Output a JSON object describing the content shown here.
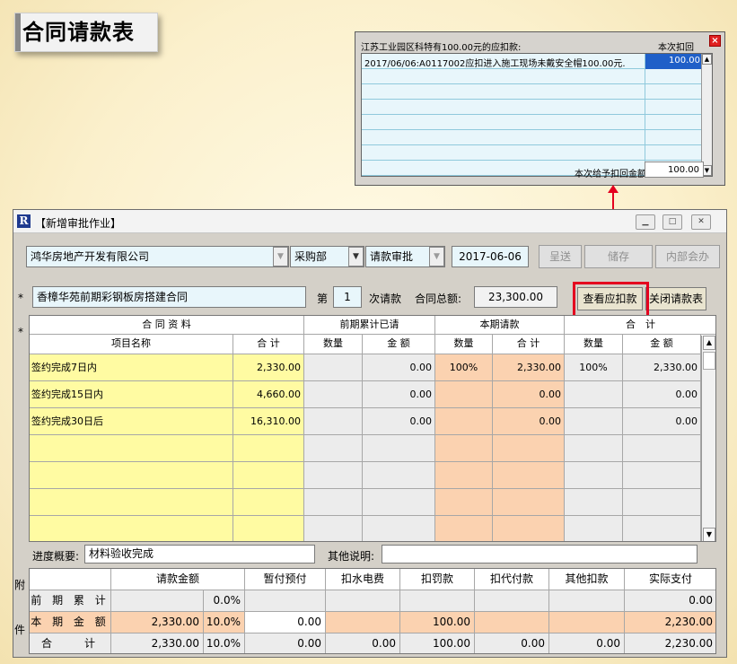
{
  "page_title": "合同请款表",
  "popup": {
    "header": "江苏工业园区科特有100.00元的应扣款:",
    "col_right": "本次扣回",
    "close": "×",
    "rows": [
      {
        "text": "2017/06/06:A0117002应扣进入施工现场未戴安全帽100.00元.",
        "amount": "100.00"
      }
    ],
    "footer_label": "本次给予扣回金额:",
    "footer_value": "100.00"
  },
  "window": {
    "title": "【新增审批作业】",
    "logo": "R",
    "company": "鸿华房地产开发有限公司",
    "department": "采购部",
    "type": "请款审批",
    "date": "2017-06-06",
    "buttons": {
      "submit": "呈送",
      "save": "储存",
      "internal": "内部会办"
    },
    "contract_name": "香樟华苑前期彩钢板房搭建合同",
    "seq_prefix": "第",
    "seq_no": "1",
    "seq_suffix": "次请款",
    "total_label": "合同总额:",
    "total_value": "23,300.00",
    "view_deduct": "查看应扣款",
    "close_form": "关闭请款表",
    "star": "*"
  },
  "items": {
    "group_headers": [
      "合 同 资 料",
      "前期累计已请",
      "本期请款",
      "合　计"
    ],
    "sub_headers": [
      "项目名称",
      "合 计",
      "数量",
      "金 额",
      "数量",
      "合 计",
      "数量",
      "金 额"
    ],
    "rows": [
      {
        "name": "签约完成7日内",
        "total": "2,330.00",
        "prev_qty": "",
        "prev_amt": "0.00",
        "cur_qty": "100%",
        "cur_amt": "2,330.00",
        "sum_qty": "100%",
        "sum_amt": "2,330.00"
      },
      {
        "name": "签约完成15日内",
        "total": "4,660.00",
        "prev_qty": "",
        "prev_amt": "0.00",
        "cur_qty": "",
        "cur_amt": "0.00",
        "sum_qty": "",
        "sum_amt": "0.00"
      },
      {
        "name": "签约完成30日后",
        "total": "16,310.00",
        "prev_qty": "",
        "prev_amt": "0.00",
        "cur_qty": "",
        "cur_amt": "0.00",
        "sum_qty": "",
        "sum_amt": "0.00"
      }
    ]
  },
  "progress": {
    "label": "进度概要:",
    "value": "材料验收完成",
    "other_label": "其他说明:",
    "other_value": ""
  },
  "side_labels": {
    "attach": "附",
    "file": "件"
  },
  "summary": {
    "headers": [
      "请款金额",
      "暂付预付",
      "扣水电费",
      "扣罚款",
      "扣代付款",
      "其他扣款",
      "实际支付"
    ],
    "rows": [
      {
        "label": "前 期 累 计",
        "amount": "",
        "pct": "0.0%",
        "advance": "",
        "water": "",
        "fine": "",
        "proxy": "",
        "other": "",
        "actual": "0.00"
      },
      {
        "label": "本 期 金 额",
        "amount": "2,330.00",
        "pct": "10.0%",
        "advance": "0.00",
        "water": "",
        "fine": "100.00",
        "proxy": "",
        "other": "",
        "actual": "2,230.00"
      },
      {
        "label": "合　　计",
        "amount": "2,330.00",
        "pct": "10.0%",
        "advance": "0.00",
        "water": "0.00",
        "fine": "100.00",
        "proxy": "0.00",
        "other": "0.00",
        "actual": "2,230.00"
      }
    ]
  },
  "colors": {
    "highlight": "#e4001f",
    "yellow": "#fffba2",
    "orange": "#fbd2b0",
    "blue": "#e8f6fb"
  }
}
